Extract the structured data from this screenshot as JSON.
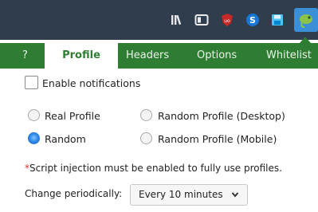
{
  "toolbar": {
    "icons": [
      "library-icon",
      "sidebar-icon",
      "ublock-icon",
      "s-extension-icon",
      "save-icon",
      "chameleon-icon"
    ]
  },
  "tabs": [
    {
      "label": "?",
      "active": false
    },
    {
      "label": "Profile",
      "active": true
    },
    {
      "label": "Headers",
      "active": false
    },
    {
      "label": "Options",
      "active": false
    },
    {
      "label": "Whitelist",
      "active": false
    }
  ],
  "profile": {
    "enable_notifications": {
      "label": "Enable notifications",
      "checked": false
    },
    "radios": {
      "real_profile": {
        "label": "Real Profile",
        "selected": false
      },
      "random_desktop": {
        "label": "Random Profile (Desktop)",
        "selected": false
      },
      "random": {
        "label": "Random",
        "selected": true
      },
      "random_mobile": {
        "label": "Random Profile (Mobile)",
        "selected": false
      }
    },
    "note_star": "*",
    "note_text": "Script injection must be enabled to fully use profiles.",
    "change_periodically_label": "Change periodically:",
    "change_periodically_value": "Every 10 minutes"
  },
  "colors": {
    "toolbar_bg": "#2f3d4c",
    "tab_bar_bg": "#2e7d32",
    "active_tab_text": "#2e7d32",
    "toolbar_active": "#3b8fd6",
    "radio_selected": "#2c86e6",
    "note_star": "#d32f2f"
  }
}
